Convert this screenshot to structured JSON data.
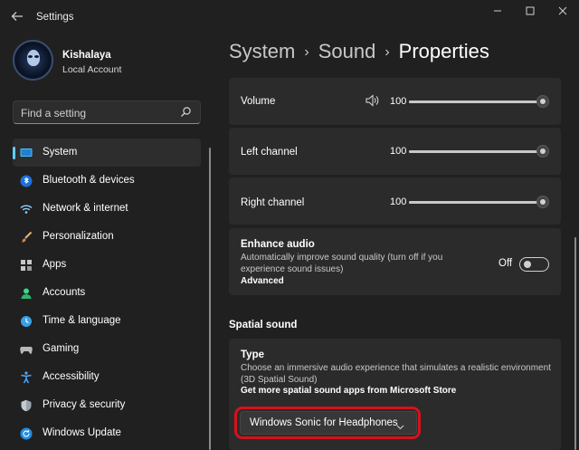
{
  "window": {
    "title": "Settings",
    "back_icon": "back-arrow-icon",
    "controls": [
      "minimize-icon",
      "maximize-icon",
      "close-icon"
    ]
  },
  "profile": {
    "name": "Kishalaya",
    "account_type": "Local Account"
  },
  "search": {
    "placeholder": "Find a setting",
    "icon": "search-icon"
  },
  "sidebar": {
    "items": [
      {
        "label": "System",
        "icon": "monitor-icon",
        "active": true
      },
      {
        "label": "Bluetooth & devices",
        "icon": "bluetooth-icon"
      },
      {
        "label": "Network & internet",
        "icon": "wifi-icon"
      },
      {
        "label": "Personalization",
        "icon": "brush-icon"
      },
      {
        "label": "Apps",
        "icon": "apps-icon"
      },
      {
        "label": "Accounts",
        "icon": "person-icon"
      },
      {
        "label": "Time & language",
        "icon": "globe-clock-icon"
      },
      {
        "label": "Gaming",
        "icon": "gamepad-icon"
      },
      {
        "label": "Accessibility",
        "icon": "accessibility-icon"
      },
      {
        "label": "Privacy & security",
        "icon": "shield-icon"
      },
      {
        "label": "Windows Update",
        "icon": "update-icon"
      }
    ]
  },
  "breadcrumb": {
    "parts": [
      "System",
      "Sound"
    ],
    "separator": "›",
    "current": "Properties"
  },
  "volume": {
    "label": "Volume",
    "value": "100",
    "level": 1.0,
    "icon": "speaker-icon"
  },
  "left_channel": {
    "label": "Left channel",
    "value": "100",
    "level": 1.0
  },
  "right_channel": {
    "label": "Right channel",
    "value": "100",
    "level": 1.0
  },
  "enhance_audio": {
    "title": "Enhance audio",
    "description": "Automatically improve sound quality (turn off if you experience sound issues)",
    "link": "Advanced",
    "toggle_label": "Off",
    "toggle_on": false
  },
  "spatial_sound": {
    "section_title": "Spatial sound",
    "type_title": "Type",
    "type_description": "Choose an immersive audio experience that simulates a realistic environment (3D Spatial Sound)",
    "link": "Get more spatial sound apps from Microsoft Store",
    "dropdown_value": "Windows Sonic for Headphones"
  },
  "colors": {
    "accent": "#60cdff",
    "highlight": "#d4121c",
    "background": "#202020",
    "card": "#2b2b2b"
  }
}
